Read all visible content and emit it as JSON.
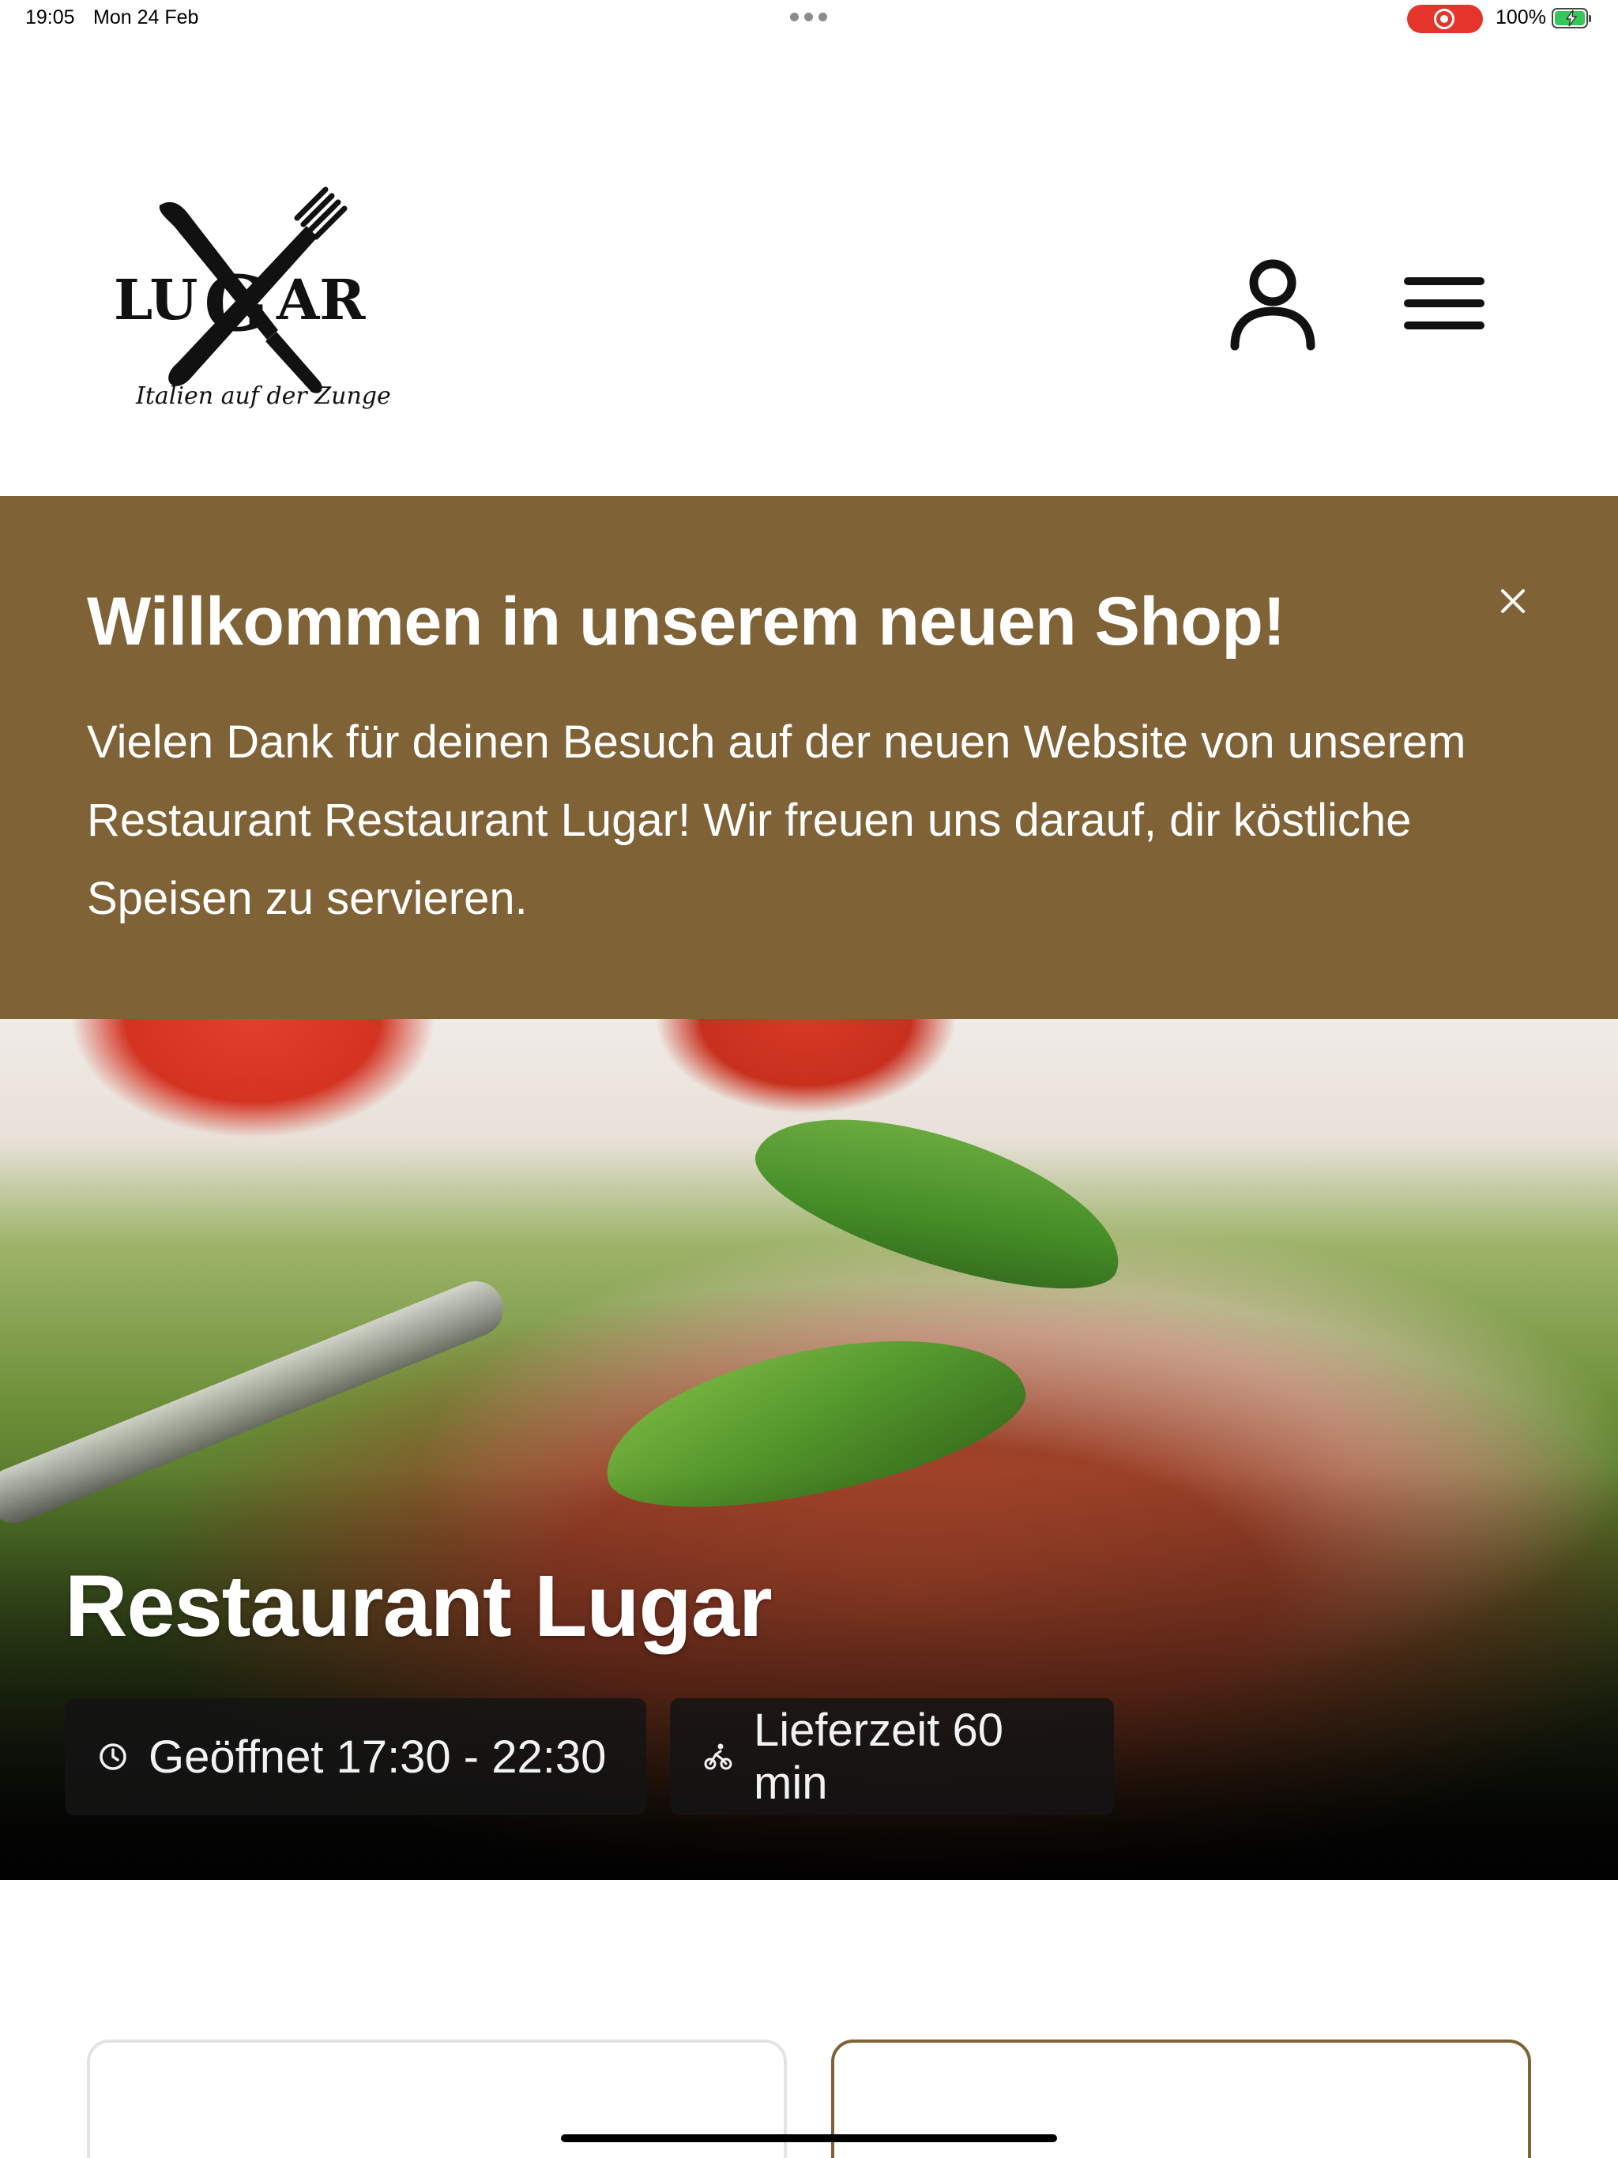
{
  "status_bar": {
    "time": "19:05",
    "date": "Mon 24 Feb",
    "battery": "100%",
    "icons": [
      "more-dots-icon",
      "screen-record-icon",
      "battery-charging-icon"
    ],
    "colors": {
      "record": "#e5342b",
      "battery": "#35c759"
    }
  },
  "header": {
    "logo": {
      "wordmark": "LUGAR",
      "tagline": "Italien auf der Zunge"
    },
    "icons": [
      "user-icon",
      "menu-icon"
    ]
  },
  "banner": {
    "title": "Willkommen in unserem neuen Shop!",
    "text": "Vielen Dank für deinen Besuch auf der neuen Website von unserem Restaurant Restaurant Lugar! Wir freuen uns darauf, dir köstliche Speisen zu servieren.",
    "close_icon": "close-icon",
    "background_color": "#7f6236"
  },
  "hero": {
    "title": "Restaurant Lugar",
    "opening_hours": "Geöffnet 17:30 - 22:30",
    "delivery_time": "Lieferzeit 60 min",
    "icons": [
      "clock-icon",
      "delivery-bike-icon"
    ]
  },
  "colors": {
    "accent": "#7f6236",
    "text": "#111111",
    "card_border": "#e3e3e3"
  }
}
